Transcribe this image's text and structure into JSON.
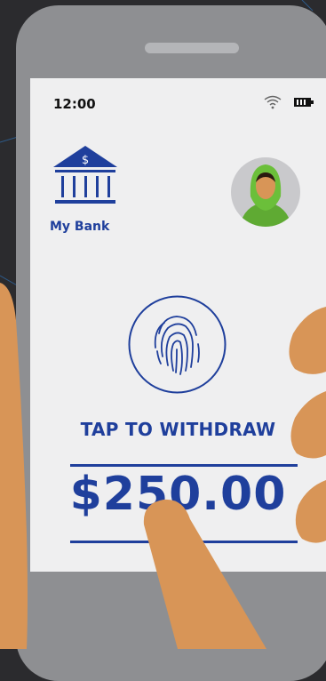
{
  "status_bar": {
    "time": "12:00",
    "wifi_icon": "wifi-icon",
    "battery_icon": "battery-icon"
  },
  "bank": {
    "name": "My Bank",
    "logo_icon": "bank-building-icon",
    "logo_symbol": "$"
  },
  "user": {
    "avatar_icon": "user-avatar"
  },
  "withdraw": {
    "fingerprint_icon": "fingerprint-icon",
    "action_label": "TAP TO WITHDRAW",
    "amount": "$250.00"
  },
  "colors": {
    "accent": "#1f3f9c",
    "screen_bg": "#efeff0",
    "phone_body": "#8e8f92",
    "background": "#2b2b2e",
    "skin": "#d89557",
    "hijab": "#6bbf3a"
  }
}
